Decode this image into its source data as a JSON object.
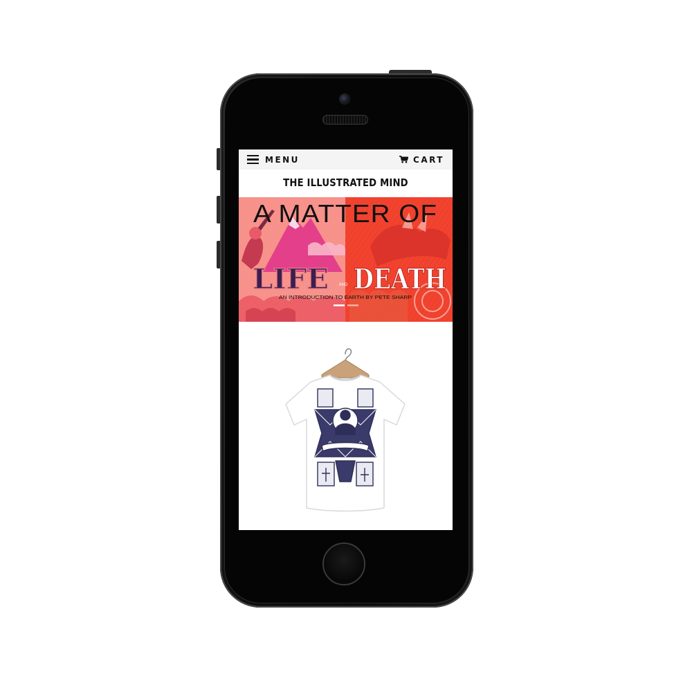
{
  "nav": {
    "menu_label": "MENU",
    "cart_label": "CART",
    "menu_icon": "hamburger-menu-icon",
    "cart_icon": "shopping-cart-icon"
  },
  "store": {
    "title": "THE ILLUSTRATED MIND"
  },
  "banner": {
    "headline": "A MATTER OF",
    "word_left": "LIFE",
    "connector": "AND",
    "word_right": "DEATH",
    "tagline": "AN INTRODUCTION TO EARTH BY PETE SHARP",
    "slide_count": 2,
    "active_slide": 1
  },
  "product": {
    "image": "illustrated-tshirt-on-hanger",
    "shirt_color": "#ffffff",
    "print_color": "#2e2f58"
  },
  "colors": {
    "banner_pink": "#f7918a",
    "banner_red": "#f2432f",
    "life_purple": "#3d1e4e",
    "accent_magenta": "#e0308a"
  }
}
